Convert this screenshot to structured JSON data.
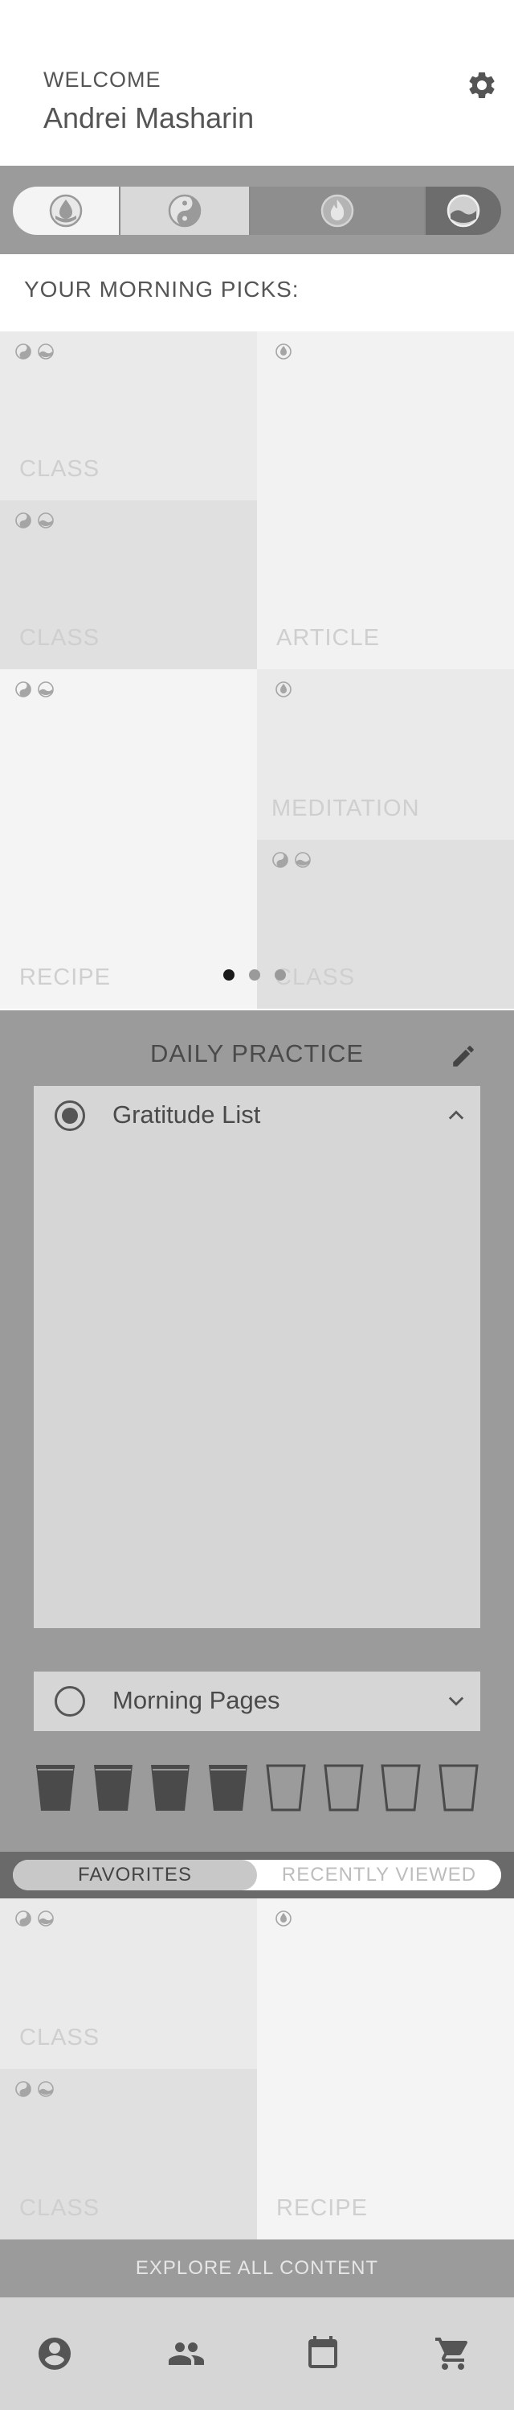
{
  "header": {
    "welcome": "WELCOME",
    "user_name": "Andrei Masharin",
    "settings_icon": "gear-icon"
  },
  "segments": [
    {
      "icon": "drop-circle-icon",
      "selected": true
    },
    {
      "icon": "yin-yang-icon",
      "selected": false
    },
    {
      "icon": "flame-icon",
      "selected": false
    },
    {
      "icon": "wave-icon",
      "selected": false
    }
  ],
  "picks": {
    "title": "YOUR MORNING PICKS:",
    "tiles": [
      {
        "label": "CLASS",
        "icons": [
          "yin-yang-icon",
          "wave-icon"
        ]
      },
      {
        "label": "CLASS",
        "icons": [
          "yin-yang-icon",
          "wave-icon"
        ]
      },
      {
        "label": "ARTICLE",
        "icons": [
          "drop-circle-icon"
        ]
      },
      {
        "label": "RECIPE",
        "icons": [
          "yin-yang-icon",
          "wave-icon"
        ]
      },
      {
        "label": "MEDITATION",
        "icons": [
          "drop-circle-icon"
        ]
      },
      {
        "label": "CLASS",
        "icons": [
          "yin-yang-icon",
          "wave-icon"
        ]
      }
    ],
    "pager": {
      "pages": 3,
      "active": 1
    }
  },
  "practice": {
    "title": "DAILY PRACTICE",
    "edit_icon": "pencil-icon",
    "items": [
      {
        "label": "Gratitude List",
        "checked": true,
        "expanded": true
      },
      {
        "label": "Morning Pages",
        "checked": false,
        "expanded": false
      }
    ],
    "water": {
      "total": 8,
      "filled": 4
    }
  },
  "library": {
    "tabs": [
      {
        "label": "FAVORITES",
        "active": true
      },
      {
        "label": "RECENTLY VIEWED",
        "active": false
      }
    ],
    "tiles": [
      {
        "label": "CLASS",
        "icons": [
          "yin-yang-icon",
          "wave-icon"
        ]
      },
      {
        "label": "CLASS",
        "icons": [
          "yin-yang-icon",
          "wave-icon"
        ]
      },
      {
        "label": "RECIPE",
        "icons": [
          "drop-circle-icon"
        ]
      }
    ],
    "explore_label": "EXPLORE ALL CONTENT"
  },
  "nav": [
    {
      "icon": "profile-icon"
    },
    {
      "icon": "community-icon"
    },
    {
      "icon": "calendar-icon"
    },
    {
      "icon": "cart-icon"
    }
  ],
  "colors": {
    "band": "#9b9b9b",
    "tile_light": "#f2f2f2",
    "tile_mid": "#eaeaea",
    "tile_dark": "#e0e0e0",
    "panel": "#d6d6d6",
    "text_dark": "#4a4a4a",
    "label_faded": "#cfcfcf"
  }
}
